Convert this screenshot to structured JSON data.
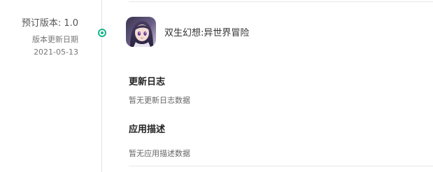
{
  "release": {
    "version_text": "预订版本: 1.0",
    "date_label": "版本更新日期",
    "date_value": "2021-05-13"
  },
  "app": {
    "name": "双生幻想:异世界冒险",
    "icon": "app-icon-anime-girl"
  },
  "changelog": {
    "title": "更新日志",
    "body": "暂无更新日志数据"
  },
  "description": {
    "title": "应用描述",
    "body": "暂无应用描述数据"
  },
  "colors": {
    "accent": "#18b58a",
    "divider": "#e6e6e6"
  }
}
